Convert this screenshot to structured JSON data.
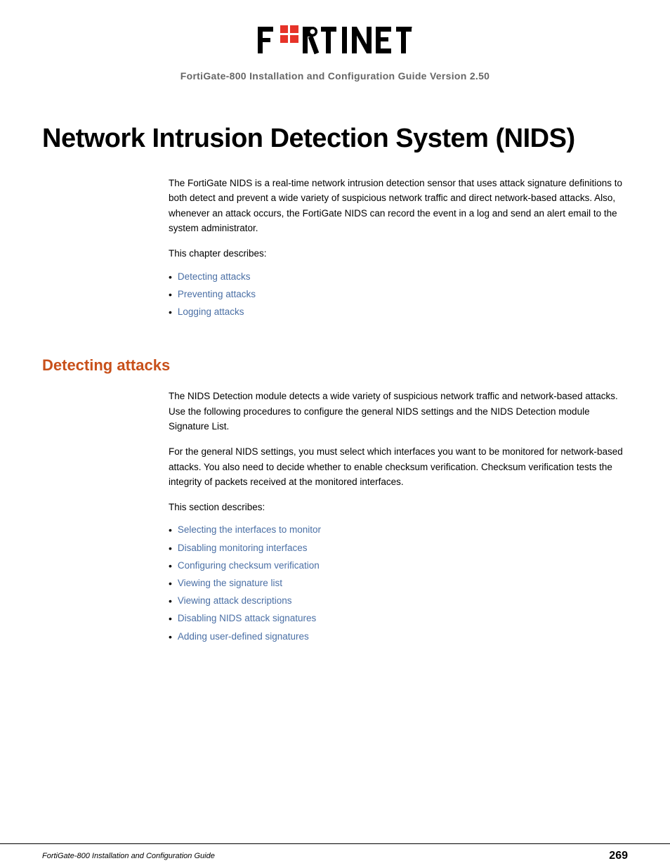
{
  "header": {
    "subtitle": "FortiGate-800 Installation and Configuration Guide Version 2.50"
  },
  "page_title": "Network Intrusion Detection System (NIDS)",
  "intro": {
    "paragraph1": "The FortiGate NIDS is a real-time network intrusion detection sensor that uses attack signature definitions to both detect and prevent a wide variety of suspicious network traffic and direct network-based attacks. Also, whenever an attack occurs, the FortiGate NIDS can record the event in a log and send an alert email to the system administrator.",
    "chapter_label": "This chapter describes:",
    "chapter_links": [
      {
        "label": "Detecting attacks",
        "href": "#"
      },
      {
        "label": "Preventing attacks",
        "href": "#"
      },
      {
        "label": "Logging attacks",
        "href": "#"
      }
    ]
  },
  "detecting_section": {
    "heading": "Detecting attacks",
    "paragraph1": "The NIDS Detection module detects a wide variety of suspicious network traffic and network-based attacks. Use the following procedures to configure the general NIDS settings and the NIDS Detection module Signature List.",
    "paragraph2": "For the general NIDS settings, you must select which interfaces you want to be monitored for network-based attacks. You also need to decide whether to enable checksum verification. Checksum verification tests the integrity of packets received at the monitored interfaces.",
    "section_label": "This section describes:",
    "section_links": [
      {
        "label": "Selecting the interfaces to monitor",
        "href": "#"
      },
      {
        "label": "Disabling monitoring interfaces",
        "href": "#"
      },
      {
        "label": "Configuring checksum verification",
        "href": "#"
      },
      {
        "label": "Viewing the signature list",
        "href": "#"
      },
      {
        "label": "Viewing attack descriptions",
        "href": "#"
      },
      {
        "label": "Disabling NIDS attack signatures",
        "href": "#"
      },
      {
        "label": "Adding user-defined signatures",
        "href": "#"
      }
    ]
  },
  "footer": {
    "left": "FortiGate-800 Installation and Configuration Guide",
    "right": "269"
  }
}
